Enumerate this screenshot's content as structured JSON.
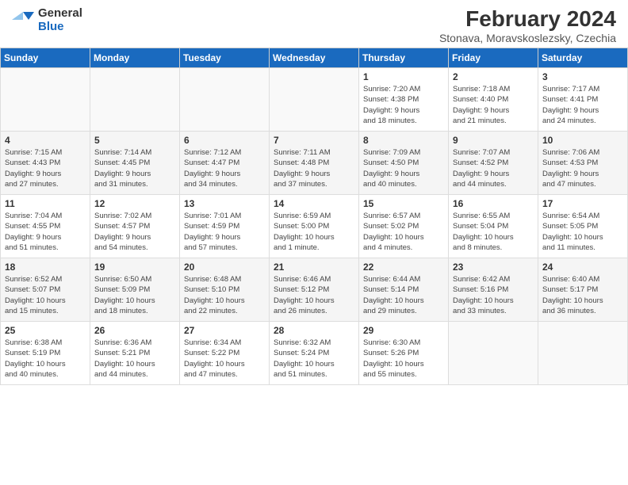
{
  "header": {
    "logo_line1": "General",
    "logo_line2": "Blue",
    "title": "February 2024",
    "subtitle": "Stonava, Moravskoslezsky, Czechia"
  },
  "days_of_week": [
    "Sunday",
    "Monday",
    "Tuesday",
    "Wednesday",
    "Thursday",
    "Friday",
    "Saturday"
  ],
  "weeks": [
    [
      {
        "day": "",
        "info": ""
      },
      {
        "day": "",
        "info": ""
      },
      {
        "day": "",
        "info": ""
      },
      {
        "day": "",
        "info": ""
      },
      {
        "day": "1",
        "info": "Sunrise: 7:20 AM\nSunset: 4:38 PM\nDaylight: 9 hours\nand 18 minutes."
      },
      {
        "day": "2",
        "info": "Sunrise: 7:18 AM\nSunset: 4:40 PM\nDaylight: 9 hours\nand 21 minutes."
      },
      {
        "day": "3",
        "info": "Sunrise: 7:17 AM\nSunset: 4:41 PM\nDaylight: 9 hours\nand 24 minutes."
      }
    ],
    [
      {
        "day": "4",
        "info": "Sunrise: 7:15 AM\nSunset: 4:43 PM\nDaylight: 9 hours\nand 27 minutes."
      },
      {
        "day": "5",
        "info": "Sunrise: 7:14 AM\nSunset: 4:45 PM\nDaylight: 9 hours\nand 31 minutes."
      },
      {
        "day": "6",
        "info": "Sunrise: 7:12 AM\nSunset: 4:47 PM\nDaylight: 9 hours\nand 34 minutes."
      },
      {
        "day": "7",
        "info": "Sunrise: 7:11 AM\nSunset: 4:48 PM\nDaylight: 9 hours\nand 37 minutes."
      },
      {
        "day": "8",
        "info": "Sunrise: 7:09 AM\nSunset: 4:50 PM\nDaylight: 9 hours\nand 40 minutes."
      },
      {
        "day": "9",
        "info": "Sunrise: 7:07 AM\nSunset: 4:52 PM\nDaylight: 9 hours\nand 44 minutes."
      },
      {
        "day": "10",
        "info": "Sunrise: 7:06 AM\nSunset: 4:53 PM\nDaylight: 9 hours\nand 47 minutes."
      }
    ],
    [
      {
        "day": "11",
        "info": "Sunrise: 7:04 AM\nSunset: 4:55 PM\nDaylight: 9 hours\nand 51 minutes."
      },
      {
        "day": "12",
        "info": "Sunrise: 7:02 AM\nSunset: 4:57 PM\nDaylight: 9 hours\nand 54 minutes."
      },
      {
        "day": "13",
        "info": "Sunrise: 7:01 AM\nSunset: 4:59 PM\nDaylight: 9 hours\nand 57 minutes."
      },
      {
        "day": "14",
        "info": "Sunrise: 6:59 AM\nSunset: 5:00 PM\nDaylight: 10 hours\nand 1 minute."
      },
      {
        "day": "15",
        "info": "Sunrise: 6:57 AM\nSunset: 5:02 PM\nDaylight: 10 hours\nand 4 minutes."
      },
      {
        "day": "16",
        "info": "Sunrise: 6:55 AM\nSunset: 5:04 PM\nDaylight: 10 hours\nand 8 minutes."
      },
      {
        "day": "17",
        "info": "Sunrise: 6:54 AM\nSunset: 5:05 PM\nDaylight: 10 hours\nand 11 minutes."
      }
    ],
    [
      {
        "day": "18",
        "info": "Sunrise: 6:52 AM\nSunset: 5:07 PM\nDaylight: 10 hours\nand 15 minutes."
      },
      {
        "day": "19",
        "info": "Sunrise: 6:50 AM\nSunset: 5:09 PM\nDaylight: 10 hours\nand 18 minutes."
      },
      {
        "day": "20",
        "info": "Sunrise: 6:48 AM\nSunset: 5:10 PM\nDaylight: 10 hours\nand 22 minutes."
      },
      {
        "day": "21",
        "info": "Sunrise: 6:46 AM\nSunset: 5:12 PM\nDaylight: 10 hours\nand 26 minutes."
      },
      {
        "day": "22",
        "info": "Sunrise: 6:44 AM\nSunset: 5:14 PM\nDaylight: 10 hours\nand 29 minutes."
      },
      {
        "day": "23",
        "info": "Sunrise: 6:42 AM\nSunset: 5:16 PM\nDaylight: 10 hours\nand 33 minutes."
      },
      {
        "day": "24",
        "info": "Sunrise: 6:40 AM\nSunset: 5:17 PM\nDaylight: 10 hours\nand 36 minutes."
      }
    ],
    [
      {
        "day": "25",
        "info": "Sunrise: 6:38 AM\nSunset: 5:19 PM\nDaylight: 10 hours\nand 40 minutes."
      },
      {
        "day": "26",
        "info": "Sunrise: 6:36 AM\nSunset: 5:21 PM\nDaylight: 10 hours\nand 44 minutes."
      },
      {
        "day": "27",
        "info": "Sunrise: 6:34 AM\nSunset: 5:22 PM\nDaylight: 10 hours\nand 47 minutes."
      },
      {
        "day": "28",
        "info": "Sunrise: 6:32 AM\nSunset: 5:24 PM\nDaylight: 10 hours\nand 51 minutes."
      },
      {
        "day": "29",
        "info": "Sunrise: 6:30 AM\nSunset: 5:26 PM\nDaylight: 10 hours\nand 55 minutes."
      },
      {
        "day": "",
        "info": ""
      },
      {
        "day": "",
        "info": ""
      }
    ]
  ]
}
